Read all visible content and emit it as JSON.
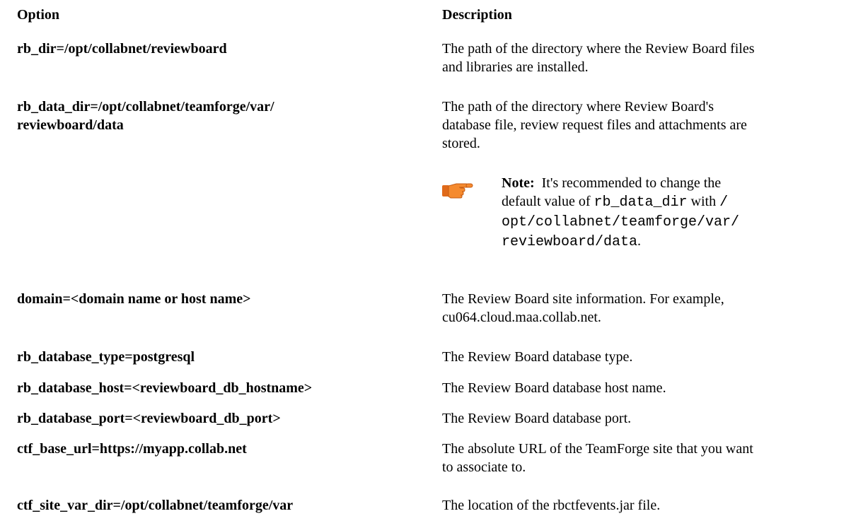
{
  "header": {
    "option": "Option",
    "description": "Description"
  },
  "rows": [
    {
      "option": "rb_dir=/opt/collabnet/reviewboard",
      "description_line1": "The path of the directory where the Review Board files",
      "description_line2": "and libraries are installed."
    },
    {
      "option_line1": "rb_data_dir=/opt/collabnet/teamforge/var/",
      "option_line2": "reviewboard/data",
      "description_line1": "The path of the directory where Review Board's",
      "description_line2": "database file, review request files and attachments are",
      "description_line3": "stored."
    },
    {
      "option": "domain=<domain name or host name>",
      "description_line1": "The Review Board site information. For example,",
      "description_line2": "cu064.cloud.maa.collab.net."
    },
    {
      "option": "rb_database_type=postgresql",
      "description_line1": "The Review Board database type."
    },
    {
      "option": "rb_database_host=<reviewboard_db_hostname>",
      "description_line1": "The Review Board database host name."
    },
    {
      "option": "rb_database_port=<reviewboard_db_port>",
      "description_line1": "The Review Board database port."
    },
    {
      "option": "ctf_base_url=https://myapp.collab.net",
      "description_line1": "The absolute URL of the TeamForge site that you want",
      "description_line2": "to associate to."
    },
    {
      "option": "ctf_site_var_dir=/opt/collabnet/teamforge/var",
      "description_line1": "The location of the rbctfevents.jar file."
    }
  ],
  "note": {
    "icon": "pointing-hand-icon",
    "label": "Note:",
    "text1": "It's recommended to change the",
    "text2": "default value of",
    "code1": "rb_data_dir",
    "text3": "with",
    "code2_line1": "/",
    "code2_line2": "opt/collabnet/teamforge/var/",
    "code2_line3": "reviewboard/data",
    "text4": "."
  }
}
